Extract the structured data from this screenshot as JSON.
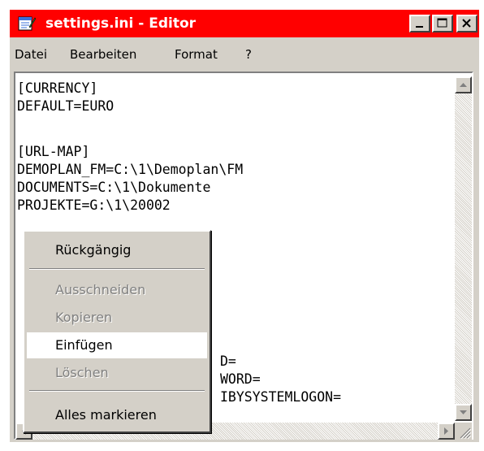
{
  "window": {
    "title": "settings.ini - Editor"
  },
  "menu": [
    "Datei",
    "Bearbeiten",
    "Format",
    "?"
  ],
  "editor": {
    "lines": [
      "[CURRENCY]",
      "DEFAULT=EURO",
      "",
      "[URL-MAP]",
      "DEMOPLAN_FM=C:\\1\\Demoplan\\FM",
      "DOCUMENTS=C:\\1\\Dokumente",
      "PROJEKTE=G:\\1\\20002"
    ],
    "partial_lines": [
      "D=",
      "WORD=",
      "IBYSYSTEMLOGON="
    ]
  },
  "context_menu": {
    "items": [
      {
        "label": "Rückgängig",
        "enabled": true
      },
      {
        "label": "Ausschneiden",
        "enabled": false
      },
      {
        "label": "Kopieren",
        "enabled": false
      },
      {
        "label": "Einfügen",
        "enabled": true,
        "highlighted": true
      },
      {
        "label": "Löschen",
        "enabled": false
      },
      {
        "label": "Alles markieren",
        "enabled": true
      }
    ]
  },
  "colors": {
    "titlebar": "#ff0000",
    "face": "#d4d0c8",
    "disabled_text": "#808080"
  },
  "icons": {
    "app": "notepad-icon",
    "minimize": "minimize-icon",
    "maximize": "maximize-icon",
    "close": "close-icon"
  }
}
